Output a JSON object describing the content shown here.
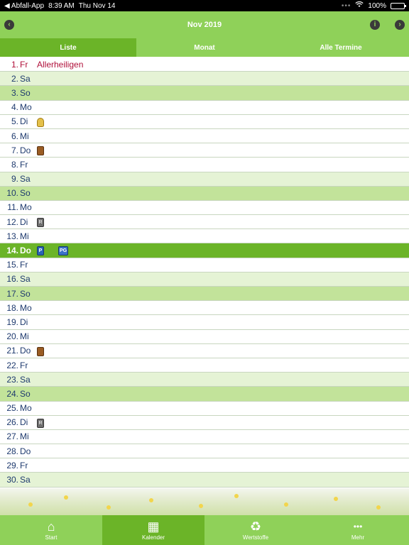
{
  "status": {
    "back_app": "◀ Abfall-App",
    "time": "8:39 AM",
    "date": "Thu Nov 14",
    "dots": "•••",
    "wifi": "wifi-icon",
    "battery": "100%"
  },
  "header": {
    "title": "Nov 2019",
    "prev_icon": "‹",
    "info_icon": "i",
    "next_icon": "›"
  },
  "tabs": [
    {
      "label": "Liste",
      "active": true
    },
    {
      "label": "Monat",
      "active": false
    },
    {
      "label": "Alle Termine",
      "active": false
    }
  ],
  "days": [
    {
      "day": "1.",
      "dow": "Fr",
      "type": "weekday",
      "holiday": "Allerheiligen"
    },
    {
      "day": "2.",
      "dow": "Sa",
      "type": "sat"
    },
    {
      "day": "3.",
      "dow": "So",
      "type": "sun"
    },
    {
      "day": "4.",
      "dow": "Mo",
      "type": "weekday"
    },
    {
      "day": "5.",
      "dow": "Di",
      "type": "weekday",
      "icons": [
        "yellow-bag-icon"
      ]
    },
    {
      "day": "6.",
      "dow": "Mi",
      "type": "weekday"
    },
    {
      "day": "7.",
      "dow": "Do",
      "type": "weekday",
      "icons": [
        "brown-bin-icon"
      ]
    },
    {
      "day": "8.",
      "dow": "Fr",
      "type": "weekday"
    },
    {
      "day": "9.",
      "dow": "Sa",
      "type": "sat"
    },
    {
      "day": "10.",
      "dow": "So",
      "type": "sun"
    },
    {
      "day": "11.",
      "dow": "Mo",
      "type": "weekday"
    },
    {
      "day": "12.",
      "dow": "Di",
      "type": "weekday",
      "icons": [
        "residual-waste-bin-icon"
      ]
    },
    {
      "day": "13.",
      "dow": "Mi",
      "type": "weekday"
    },
    {
      "day": "14.",
      "dow": "Do",
      "type": "today",
      "icons": [
        "paper-bin-icon",
        "blue-container-icon"
      ]
    },
    {
      "day": "15.",
      "dow": "Fr",
      "type": "weekday"
    },
    {
      "day": "16.",
      "dow": "Sa",
      "type": "sat"
    },
    {
      "day": "17.",
      "dow": "So",
      "type": "sun"
    },
    {
      "day": "18.",
      "dow": "Mo",
      "type": "weekday"
    },
    {
      "day": "19.",
      "dow": "Di",
      "type": "weekday"
    },
    {
      "day": "20.",
      "dow": "Mi",
      "type": "weekday"
    },
    {
      "day": "21.",
      "dow": "Do",
      "type": "weekday",
      "icons": [
        "brown-bin-icon"
      ]
    },
    {
      "day": "22.",
      "dow": "Fr",
      "type": "weekday"
    },
    {
      "day": "23.",
      "dow": "Sa",
      "type": "sat"
    },
    {
      "day": "24.",
      "dow": "So",
      "type": "sun"
    },
    {
      "day": "25.",
      "dow": "Mo",
      "type": "weekday"
    },
    {
      "day": "26.",
      "dow": "Di",
      "type": "weekday",
      "icons": [
        "residual-waste-bin-icon"
      ]
    },
    {
      "day": "27.",
      "dow": "Mi",
      "type": "weekday"
    },
    {
      "day": "28.",
      "dow": "Do",
      "type": "weekday"
    },
    {
      "day": "29.",
      "dow": "Fr",
      "type": "weekday"
    },
    {
      "day": "30.",
      "dow": "Sa",
      "type": "sat"
    }
  ],
  "icon_letters": {
    "residual-waste-bin-icon": "R",
    "paper-bin-icon": "P",
    "blue-container-icon": "PG"
  },
  "tabbar": [
    {
      "label": "Start",
      "icon": "home-icon",
      "glyph": "⌂",
      "active": false
    },
    {
      "label": "Kalender",
      "icon": "calendar-icon",
      "glyph": "▦",
      "active": true
    },
    {
      "label": "Wertstoffe",
      "icon": "recycle-icon",
      "glyph": "♻",
      "active": false
    },
    {
      "label": "Mehr",
      "icon": "more-icon",
      "glyph": "•••",
      "active": false
    }
  ],
  "colors": {
    "header": "#8fd159",
    "active": "#6bb428",
    "holiday": "#b0103a"
  }
}
